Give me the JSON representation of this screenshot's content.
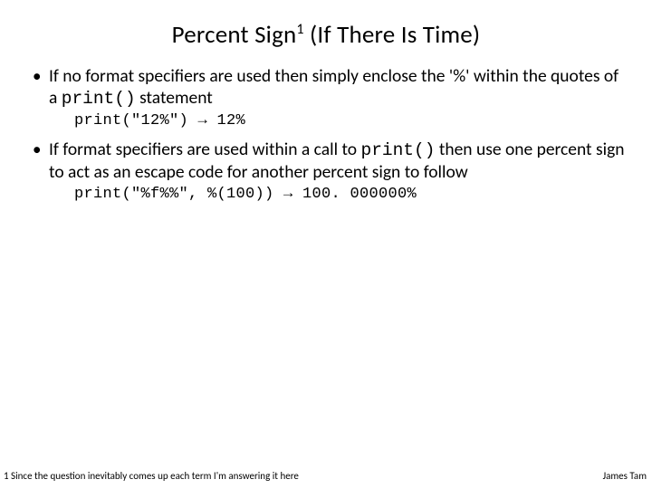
{
  "title": {
    "pre": "Percent Sign",
    "sup": "1",
    "post": " (If There Is Time)"
  },
  "bullets": [
    {
      "text_a": "If no format specifiers are used then simply enclose the '%' within the quotes of a ",
      "code_a": "print()",
      "text_b": " statement",
      "code_line": "print(\"12%\") → 12%"
    },
    {
      "text_a": "If format specifiers are used within a call to ",
      "code_a": "print()",
      "text_b": " then use one percent sign to act as an escape code for another percent sign to follow",
      "code_line": "print(\"%f%%\", %(100)) → 100. 000000%"
    }
  ],
  "footnote": "1 Since the question inevitably comes up each term I'm answering it here",
  "author": "James Tam"
}
